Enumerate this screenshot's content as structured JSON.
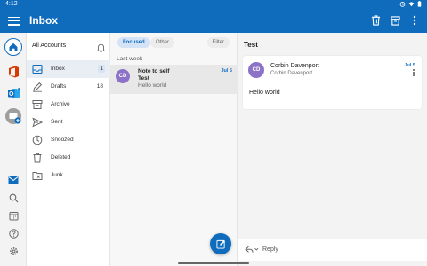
{
  "status_bar": {
    "time": "4:12",
    "icons": [
      "alarm-icon",
      "wifi-icon",
      "battery-icon"
    ]
  },
  "app_bar": {
    "title": "Inbox",
    "actions": [
      "delete-icon",
      "archive-icon",
      "more-vert-icon"
    ]
  },
  "rail": {
    "items": [
      "home-icon",
      "office-icon",
      "outlook-icon",
      "add-account-icon",
      "mail-icon",
      "search-icon",
      "calendar-icon",
      "help-icon",
      "settings-icon"
    ]
  },
  "folders": {
    "account_label": "All Accounts",
    "items": [
      {
        "label": "Inbox",
        "count": "1",
        "icon": "inbox-icon",
        "active": true
      },
      {
        "label": "Drafts",
        "count": "18",
        "icon": "drafts-icon",
        "active": false
      },
      {
        "label": "Archive",
        "count": "",
        "icon": "archive-icon",
        "active": false
      },
      {
        "label": "Sent",
        "count": "",
        "icon": "sent-icon",
        "active": false
      },
      {
        "label": "Snoozed",
        "count": "",
        "icon": "snoozed-icon",
        "active": false
      },
      {
        "label": "Deleted",
        "count": "",
        "icon": "deleted-icon",
        "active": false
      },
      {
        "label": "Junk",
        "count": "",
        "icon": "junk-icon",
        "active": false
      }
    ]
  },
  "message_list": {
    "tabs": {
      "focused": "Focused",
      "other": "Other"
    },
    "filter_label": "Filter",
    "section_header": "Last week",
    "messages": [
      {
        "initials": "CD",
        "sender": "Note to self",
        "date": "Jul 5",
        "subject": "Test",
        "preview": "Hello world"
      }
    ]
  },
  "reading_pane": {
    "subject": "Test",
    "sender_initials": "CD",
    "sender_name": "Corbin Davenport",
    "sender_email": "Corbin Davenport",
    "date": "Jul 5",
    "body": "Hello world",
    "reply_label": "Reply"
  },
  "colors": {
    "accent": "#0f6cbd",
    "avatar": "#8c73c8",
    "selected_row": "#e8e8e8"
  }
}
